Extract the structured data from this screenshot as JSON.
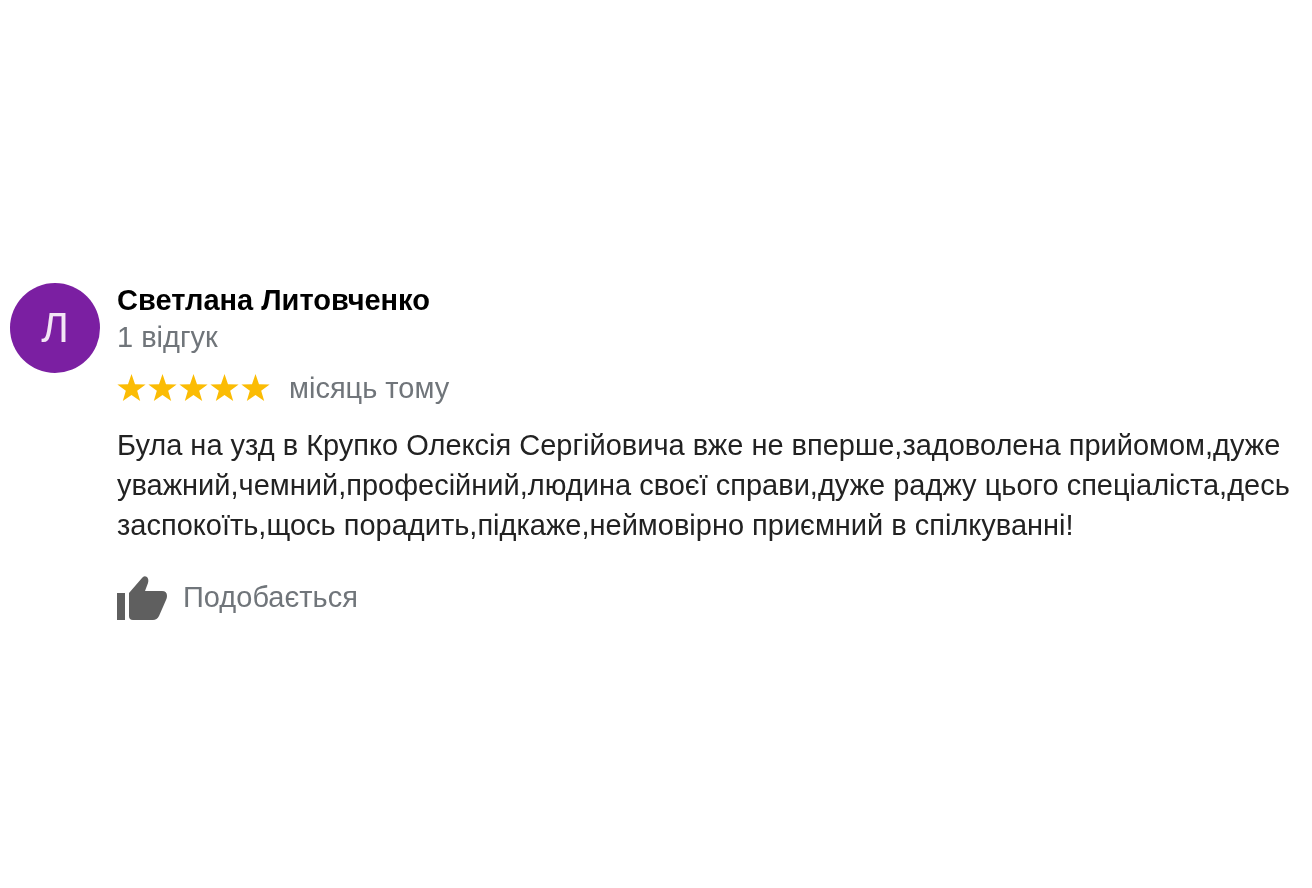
{
  "reviews": [
    {
      "author": {
        "initial": "Л",
        "name": "Светлана Литовченко",
        "review_count": "1 відгук"
      },
      "stars": 5,
      "date": "місяць тому",
      "text": "Була на узд в Крупко Олексія Сергійовича вже не вперше,задоволена прийомом,дуже уважний,чемний,професійний,людина своєї справи,дуже раджу цього спеціаліста,десь заспокоїть,щось порадить,підкаже,неймовірно приємний в спілкуванні!",
      "like_button": {
        "label": "Подобається"
      }
    }
  ]
}
